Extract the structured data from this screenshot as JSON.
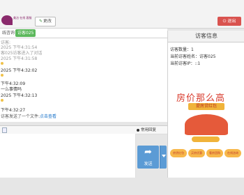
{
  "header": {
    "logo_text": "美洽 在线 客服",
    "logo_sub": "Meiqia Online Service",
    "change_label": "更改",
    "logout_label": "退出"
  },
  "tabs": [
    {
      "label": "线咨询"
    },
    {
      "label": "访客025"
    }
  ],
  "chat": {
    "lines": [
      {
        "text": "访客:",
        "style": "gray"
      },
      {
        "text": "2025 下午4:31:54",
        "style": "gray"
      },
      {
        "text": "客025访客进入了对话",
        "style": "gray"
      },
      {
        "text": "2025 下午4:31:58",
        "style": "gray"
      },
      {
        "text": "2025 下午4:32:02",
        "style": "dark"
      },
      {
        "text": "下午4:32:09",
        "style": "dark"
      },
      {
        "text": "一么事情吗",
        "style": "dark"
      },
      {
        "text": "2025 下午4:32:13",
        "style": "dark"
      },
      {
        "text": "下午4:32:27",
        "style": "dark"
      }
    ],
    "file_line": "访客发送了一个文件:",
    "file_link": "点击查看"
  },
  "toolbar": {
    "phrases_label": "常用回复"
  },
  "send": {
    "label": "发送"
  },
  "visitor_panel": {
    "title": "访客信息",
    "count_label": "访客数量：1",
    "current_name": "当前访客姓名：访客025",
    "current_ip": "当前访客IP：::1"
  },
  "banner": {
    "headline": "房价那么高",
    "sub": "提房贷红包",
    "pills": [
      "房贷红包",
      "买房优惠",
      "看房团购",
      "在线咨询"
    ]
  },
  "colors": {
    "accent_green": "#5cb85c",
    "logout_red": "#d9534f",
    "send_blue": "#5b9bd5",
    "logo_purple": "#8a2a6c"
  }
}
